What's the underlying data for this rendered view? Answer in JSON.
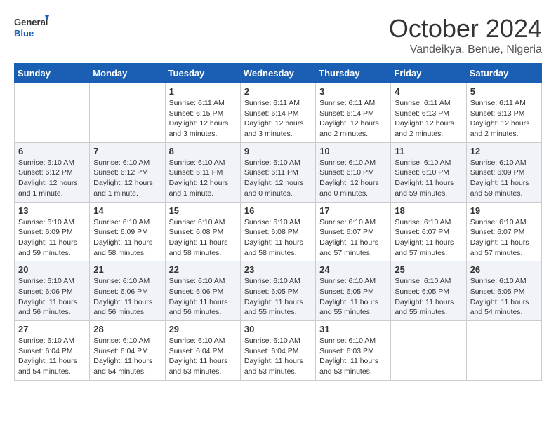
{
  "logo": {
    "text_general": "General",
    "text_blue": "Blue"
  },
  "title": "October 2024",
  "subtitle": "Vandeikya, Benue, Nigeria",
  "days_of_week": [
    "Sunday",
    "Monday",
    "Tuesday",
    "Wednesday",
    "Thursday",
    "Friday",
    "Saturday"
  ],
  "weeks": [
    [
      {
        "day": "",
        "info": ""
      },
      {
        "day": "",
        "info": ""
      },
      {
        "day": "1",
        "info": "Sunrise: 6:11 AM\nSunset: 6:15 PM\nDaylight: 12 hours and 3 minutes."
      },
      {
        "day": "2",
        "info": "Sunrise: 6:11 AM\nSunset: 6:14 PM\nDaylight: 12 hours and 3 minutes."
      },
      {
        "day": "3",
        "info": "Sunrise: 6:11 AM\nSunset: 6:14 PM\nDaylight: 12 hours and 2 minutes."
      },
      {
        "day": "4",
        "info": "Sunrise: 6:11 AM\nSunset: 6:13 PM\nDaylight: 12 hours and 2 minutes."
      },
      {
        "day": "5",
        "info": "Sunrise: 6:11 AM\nSunset: 6:13 PM\nDaylight: 12 hours and 2 minutes."
      }
    ],
    [
      {
        "day": "6",
        "info": "Sunrise: 6:10 AM\nSunset: 6:12 PM\nDaylight: 12 hours and 1 minute."
      },
      {
        "day": "7",
        "info": "Sunrise: 6:10 AM\nSunset: 6:12 PM\nDaylight: 12 hours and 1 minute."
      },
      {
        "day": "8",
        "info": "Sunrise: 6:10 AM\nSunset: 6:11 PM\nDaylight: 12 hours and 1 minute."
      },
      {
        "day": "9",
        "info": "Sunrise: 6:10 AM\nSunset: 6:11 PM\nDaylight: 12 hours and 0 minutes."
      },
      {
        "day": "10",
        "info": "Sunrise: 6:10 AM\nSunset: 6:10 PM\nDaylight: 12 hours and 0 minutes."
      },
      {
        "day": "11",
        "info": "Sunrise: 6:10 AM\nSunset: 6:10 PM\nDaylight: 11 hours and 59 minutes."
      },
      {
        "day": "12",
        "info": "Sunrise: 6:10 AM\nSunset: 6:09 PM\nDaylight: 11 hours and 59 minutes."
      }
    ],
    [
      {
        "day": "13",
        "info": "Sunrise: 6:10 AM\nSunset: 6:09 PM\nDaylight: 11 hours and 59 minutes."
      },
      {
        "day": "14",
        "info": "Sunrise: 6:10 AM\nSunset: 6:09 PM\nDaylight: 11 hours and 58 minutes."
      },
      {
        "day": "15",
        "info": "Sunrise: 6:10 AM\nSunset: 6:08 PM\nDaylight: 11 hours and 58 minutes."
      },
      {
        "day": "16",
        "info": "Sunrise: 6:10 AM\nSunset: 6:08 PM\nDaylight: 11 hours and 58 minutes."
      },
      {
        "day": "17",
        "info": "Sunrise: 6:10 AM\nSunset: 6:07 PM\nDaylight: 11 hours and 57 minutes."
      },
      {
        "day": "18",
        "info": "Sunrise: 6:10 AM\nSunset: 6:07 PM\nDaylight: 11 hours and 57 minutes."
      },
      {
        "day": "19",
        "info": "Sunrise: 6:10 AM\nSunset: 6:07 PM\nDaylight: 11 hours and 57 minutes."
      }
    ],
    [
      {
        "day": "20",
        "info": "Sunrise: 6:10 AM\nSunset: 6:06 PM\nDaylight: 11 hours and 56 minutes."
      },
      {
        "day": "21",
        "info": "Sunrise: 6:10 AM\nSunset: 6:06 PM\nDaylight: 11 hours and 56 minutes."
      },
      {
        "day": "22",
        "info": "Sunrise: 6:10 AM\nSunset: 6:06 PM\nDaylight: 11 hours and 56 minutes."
      },
      {
        "day": "23",
        "info": "Sunrise: 6:10 AM\nSunset: 6:05 PM\nDaylight: 11 hours and 55 minutes."
      },
      {
        "day": "24",
        "info": "Sunrise: 6:10 AM\nSunset: 6:05 PM\nDaylight: 11 hours and 55 minutes."
      },
      {
        "day": "25",
        "info": "Sunrise: 6:10 AM\nSunset: 6:05 PM\nDaylight: 11 hours and 55 minutes."
      },
      {
        "day": "26",
        "info": "Sunrise: 6:10 AM\nSunset: 6:05 PM\nDaylight: 11 hours and 54 minutes."
      }
    ],
    [
      {
        "day": "27",
        "info": "Sunrise: 6:10 AM\nSunset: 6:04 PM\nDaylight: 11 hours and 54 minutes."
      },
      {
        "day": "28",
        "info": "Sunrise: 6:10 AM\nSunset: 6:04 PM\nDaylight: 11 hours and 54 minutes."
      },
      {
        "day": "29",
        "info": "Sunrise: 6:10 AM\nSunset: 6:04 PM\nDaylight: 11 hours and 53 minutes."
      },
      {
        "day": "30",
        "info": "Sunrise: 6:10 AM\nSunset: 6:04 PM\nDaylight: 11 hours and 53 minutes."
      },
      {
        "day": "31",
        "info": "Sunrise: 6:10 AM\nSunset: 6:03 PM\nDaylight: 11 hours and 53 minutes."
      },
      {
        "day": "",
        "info": ""
      },
      {
        "day": "",
        "info": ""
      }
    ]
  ]
}
